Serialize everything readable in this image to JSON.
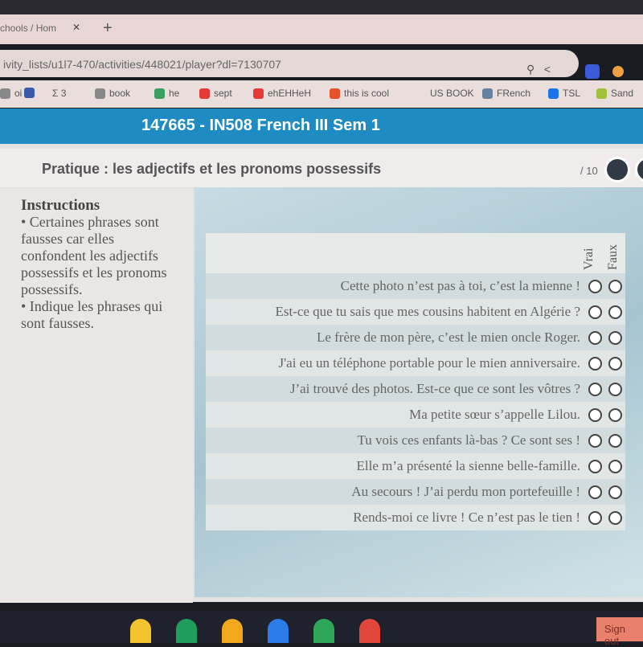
{
  "browser": {
    "tab_title": "chools / Hom",
    "new_tab": "+",
    "url": "ivity_lists/u1l7-470/activities/448021/player?dl=7130707",
    "bookmarks": [
      {
        "label": "oi",
        "color": "#888"
      },
      {
        "label": "",
        "color": "#3a5aa8"
      },
      {
        "label": "Σ 3",
        "color": ""
      },
      {
        "label": "book",
        "color": "#888"
      },
      {
        "label": "he",
        "color": "#3aa060"
      },
      {
        "label": "sept",
        "color": "#e53935"
      },
      {
        "label": "ehEHHeH",
        "color": "#e53935"
      },
      {
        "label": "this is cool",
        "color": "#e6502a"
      },
      {
        "label": "US BOOK",
        "color": ""
      },
      {
        "label": "FRench",
        "color": "#6680a0"
      },
      {
        "label": "TSL",
        "color": "#1a73e8"
      },
      {
        "label": "Sand",
        "color": "#a2c13a"
      }
    ]
  },
  "header": {
    "title": "147665 - IN508 French III Sem 1",
    "color": "#1e8cc2"
  },
  "activity": {
    "title": "Pratique : les adjectifs et les pronoms possessifs",
    "count": "/ 10"
  },
  "instructions": {
    "heading": "Instructions",
    "lines": [
      "• Certaines phrases sont fausses car elles confondent les adjectifs possessifs et les pronoms possessifs.",
      "• Indique les phrases qui sont fausses."
    ]
  },
  "table": {
    "columns": [
      "Vrai",
      "Faux"
    ],
    "rows": [
      "Cette photo n’est pas à toi, c’est la mienne !",
      "Est-ce que tu sais que mes cousins habitent en Algérie ?",
      "Le frère de mon père, c’est le mien oncle Roger.",
      "J'ai eu un téléphone portable pour le mien anniversaire.",
      "J’ai trouvé des photos. Est-ce que ce sont les vôtres ?",
      "Ma petite sœur s’appelle Lilou.",
      "Tu vois ces enfants là-bas ? Ce sont ses !",
      "Elle m’a présenté la sienne belle-famille.",
      "Au secours ! J’ai perdu mon portefeuille !",
      "Rends-moi ce livre ! Ce n’est pas le tien !"
    ]
  },
  "shelf": {
    "apps": [
      "drive",
      "sheets",
      "slides",
      "docs",
      "calculator",
      "chrome"
    ],
    "sign_out": "Sign out"
  }
}
